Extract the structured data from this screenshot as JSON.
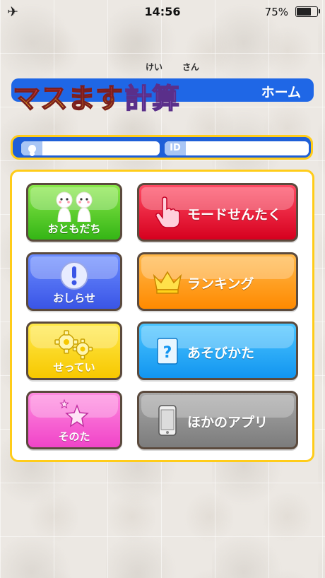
{
  "status_bar": {
    "time": "14:56",
    "battery_percent": "75%",
    "battery_level": 0.75
  },
  "header": {
    "logo_text": "マスます",
    "logo_text_2": "計算",
    "ruby_1": "けい",
    "ruby_2": "さん",
    "home_label": "ホーム"
  },
  "profile": {
    "id_label": "ID",
    "name_value": "",
    "id_value": ""
  },
  "menu": {
    "friends": "おともだち",
    "mode_select": "モードせんたく",
    "news": "おしらせ",
    "ranking": "ランキング",
    "settings": "せってい",
    "how_to_play": "あそびかた",
    "other": "そのた",
    "other_apps": "ほかのアプリ"
  },
  "colors": {
    "accent_blue": "#1f67e6",
    "frame_yellow": "#ffcc19"
  }
}
